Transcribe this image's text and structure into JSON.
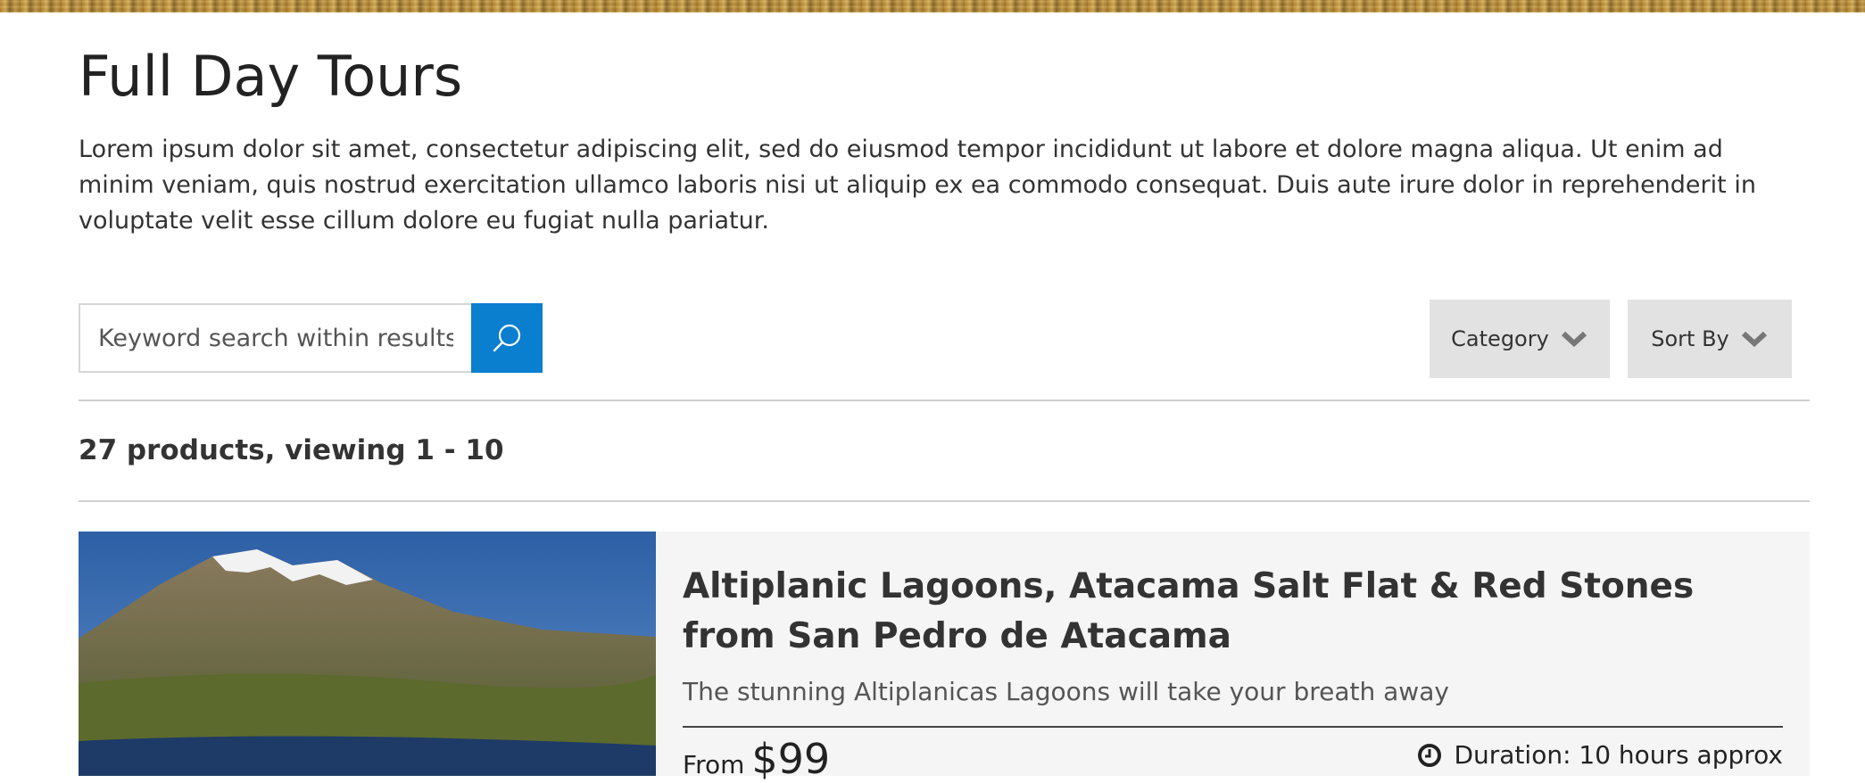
{
  "page": {
    "title": "Full Day Tours",
    "intro": "Lorem ipsum dolor sit amet, consectetur adipiscing elit, sed do eiusmod tempor incididunt ut labore et dolore magna aliqua. Ut enim ad minim veniam, quis nostrud exercitation ullamco laboris nisi ut aliquip ex ea commodo consequat. Duis aute irure dolor in reprehenderit in voluptate velit esse cillum dolore eu fugiat nulla pariatur."
  },
  "search": {
    "placeholder": "Keyword search within results",
    "value": "",
    "icon": "search-icon"
  },
  "filters": {
    "category_label": "Category",
    "sort_label": "Sort By",
    "icon": "chevron-down-icon"
  },
  "results": {
    "count_text": "27 products, viewing 1 - 10"
  },
  "products": [
    {
      "title": "Altiplanic Lagoons, Atacama Salt Flat & Red Stones from San Pedro de Atacama",
      "subtitle": "The stunning Altiplanicas Lagoons will take your breath away",
      "price_prefix": "From",
      "price": "$99",
      "duration": "Duration: 10 hours approx",
      "duration_icon": "clock-icon"
    }
  ],
  "colors": {
    "accent": "#0a7ecf",
    "dropdown_bg": "#e2e2e2",
    "card_bg": "#f5f5f5",
    "text": "#333333"
  }
}
